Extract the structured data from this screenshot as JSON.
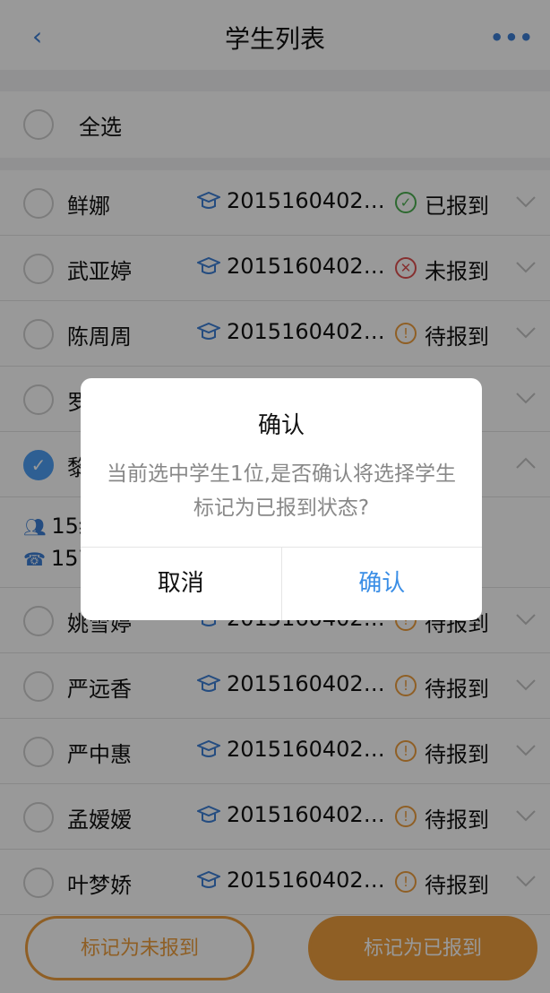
{
  "header": {
    "title": "学生列表",
    "back_icon": "chevron-left-icon",
    "more_icon": "more-dots-icon"
  },
  "select_all": {
    "label": "全选",
    "checked": false
  },
  "colors": {
    "accent": "#ee9e3e",
    "blue": "#3d7fd6",
    "registered": "#4caf50",
    "unregistered": "#e05050",
    "pending": "#ee9e3e"
  },
  "students": [
    {
      "name": "鲜娜",
      "id": "2015160402…",
      "status": "已报到",
      "status_type": "registered",
      "checked": false,
      "expanded": false
    },
    {
      "name": "武亚婷",
      "id": "2015160402…",
      "status": "未报到",
      "status_type": "unregistered",
      "checked": false,
      "expanded": false
    },
    {
      "name": "陈周周",
      "id": "2015160402…",
      "status": "待报到",
      "status_type": "pending",
      "checked": false,
      "expanded": false
    },
    {
      "name": "罗",
      "id": "",
      "status": "到",
      "status_type": "pending",
      "checked": false,
      "expanded": false
    },
    {
      "name": "黎",
      "id": "",
      "status": "到",
      "status_type": "pending",
      "checked": true,
      "expanded": true,
      "class_info": "15级",
      "phone": "157"
    },
    {
      "name": "姚雪婷",
      "id": "2015160402…",
      "status": "待报到",
      "status_type": "pending",
      "checked": false,
      "expanded": false
    },
    {
      "name": "严远香",
      "id": "2015160402…",
      "status": "待报到",
      "status_type": "pending",
      "checked": false,
      "expanded": false
    },
    {
      "name": "严中惠",
      "id": "2015160402…",
      "status": "待报到",
      "status_type": "pending",
      "checked": false,
      "expanded": false
    },
    {
      "name": "孟嫒嫒",
      "id": "2015160402…",
      "status": "待报到",
      "status_type": "pending",
      "checked": false,
      "expanded": false
    },
    {
      "name": "叶梦娇",
      "id": "2015160402…",
      "status": "待报到",
      "status_type": "pending",
      "checked": false,
      "expanded": false
    }
  ],
  "actions": {
    "mark_unregistered": "标记为未报到",
    "mark_registered": "标记为已报到"
  },
  "dialog": {
    "title": "确认",
    "message": "当前选中学生1位,是否确认将选择学生标记为已报到状态?",
    "cancel": "取消",
    "confirm": "确认"
  }
}
